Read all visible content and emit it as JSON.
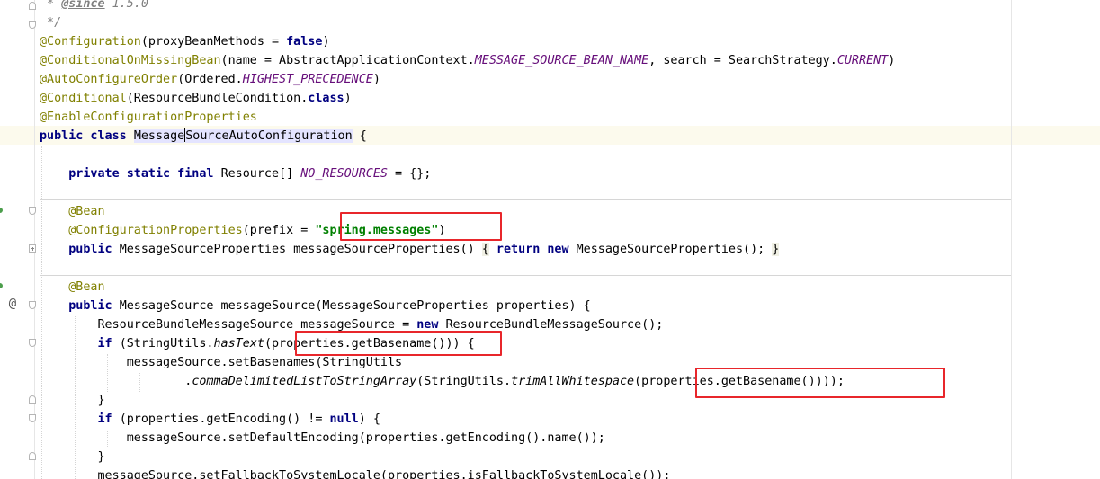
{
  "editor": {
    "lines": [
      {
        "id": "l1",
        "tokens": [
          {
            "t": " * ",
            "c": "cm"
          },
          {
            "t": "@since",
            "c": "cmtag"
          },
          {
            "t": " 1.5.0",
            "c": "cm"
          }
        ]
      },
      {
        "id": "l2",
        "tokens": [
          {
            "t": " */",
            "c": "cm"
          }
        ]
      },
      {
        "id": "l3",
        "tokens": [
          {
            "t": "@Configuration",
            "c": "ann"
          },
          {
            "t": "(proxyBeanMethods = "
          },
          {
            "t": "false",
            "c": "kw"
          },
          {
            "t": ")"
          }
        ]
      },
      {
        "id": "l4",
        "tokens": [
          {
            "t": "@ConditionalOnMissingBean",
            "c": "ann"
          },
          {
            "t": "(name = AbstractApplicationContext."
          },
          {
            "t": "MESSAGE_SOURCE_BEAN_NAME",
            "c": "field"
          },
          {
            "t": ", search = SearchStrategy."
          },
          {
            "t": "CURRENT",
            "c": "field"
          },
          {
            "t": ")"
          }
        ]
      },
      {
        "id": "l5",
        "tokens": [
          {
            "t": "@AutoConfigureOrder",
            "c": "ann"
          },
          {
            "t": "(Ordered."
          },
          {
            "t": "HIGHEST_PRECEDENCE",
            "c": "field"
          },
          {
            "t": ")"
          }
        ]
      },
      {
        "id": "l6",
        "tokens": [
          {
            "t": "@Conditional",
            "c": "ann"
          },
          {
            "t": "(ResourceBundleCondition."
          },
          {
            "t": "class",
            "c": "kw"
          },
          {
            "t": ")"
          }
        ]
      },
      {
        "id": "l7",
        "tokens": [
          {
            "t": "@EnableConfigurationProperties",
            "c": "ann"
          }
        ]
      },
      {
        "id": "l8",
        "tokens": [
          {
            "t": "public class ",
            "c": "kw"
          },
          {
            "t": "Message",
            "c": "cls-hl"
          },
          {
            "caret": true
          },
          {
            "t": "SourceAutoConfiguration",
            "c": "cls-hl"
          },
          {
            "t": " {"
          }
        ]
      },
      {
        "id": "l9",
        "tokens": []
      },
      {
        "id": "l10",
        "tokens": [
          {
            "t": "    "
          },
          {
            "t": "private static final ",
            "c": "kw"
          },
          {
            "t": "Resource[] "
          },
          {
            "t": "NO_RESOURCES",
            "c": "field"
          },
          {
            "t": " = {};"
          }
        ]
      },
      {
        "id": "l11",
        "tokens": []
      },
      {
        "id": "l12",
        "tokens": [
          {
            "t": "    "
          },
          {
            "t": "@Bean",
            "c": "ann"
          }
        ]
      },
      {
        "id": "l13",
        "tokens": [
          {
            "t": "    "
          },
          {
            "t": "@ConfigurationProperties",
            "c": "ann"
          },
          {
            "t": "(prefix = "
          },
          {
            "t": "\"spring.messages\"",
            "c": "str"
          },
          {
            "t": ")"
          }
        ]
      },
      {
        "id": "l14",
        "tokens": [
          {
            "t": "    "
          },
          {
            "t": "public ",
            "c": "kw"
          },
          {
            "t": "MessageSourceProperties messageSourceProperties() "
          },
          {
            "t": "{",
            "c": "brace"
          },
          {
            "t": " "
          },
          {
            "t": "return new ",
            "c": "kw"
          },
          {
            "t": "MessageSourceProperties(); "
          },
          {
            "t": "}",
            "c": "brace"
          }
        ]
      },
      {
        "id": "l15",
        "tokens": []
      },
      {
        "id": "l16",
        "tokens": [
          {
            "t": "    "
          },
          {
            "t": "@Bean",
            "c": "ann"
          }
        ]
      },
      {
        "id": "l17",
        "tokens": [
          {
            "t": "    "
          },
          {
            "t": "public ",
            "c": "kw"
          },
          {
            "t": "MessageSource messageSource(MessageSourceProperties properties) {"
          }
        ]
      },
      {
        "id": "l18",
        "tokens": [
          {
            "t": "        ResourceBundleMessageSource messageSource = "
          },
          {
            "t": "new ",
            "c": "kw"
          },
          {
            "t": "ResourceBundleMessageSource();"
          }
        ]
      },
      {
        "id": "l19",
        "tokens": [
          {
            "t": "        "
          },
          {
            "t": "if ",
            "c": "kw"
          },
          {
            "t": "(StringUtils."
          },
          {
            "t": "hasText",
            "c": "static"
          },
          {
            "t": "(properties.getBasename())) {"
          }
        ]
      },
      {
        "id": "l20",
        "tokens": [
          {
            "t": "            messageSource.setBasenames(StringUtils"
          }
        ]
      },
      {
        "id": "l21",
        "tokens": [
          {
            "t": "                    ."
          },
          {
            "t": "commaDelimitedListToStringArray",
            "c": "static"
          },
          {
            "t": "(StringUtils."
          },
          {
            "t": "trimAllWhitespace",
            "c": "static"
          },
          {
            "t": "(properties.getBasename())));"
          }
        ]
      },
      {
        "id": "l22",
        "tokens": [
          {
            "t": "        }"
          }
        ]
      },
      {
        "id": "l23",
        "tokens": [
          {
            "t": "        "
          },
          {
            "t": "if ",
            "c": "kw"
          },
          {
            "t": "(properties.getEncoding() != "
          },
          {
            "t": "null",
            "c": "kw"
          },
          {
            "t": ") {"
          }
        ]
      },
      {
        "id": "l24",
        "tokens": [
          {
            "t": "            messageSource.setDefaultEncoding(properties.getEncoding().name());"
          }
        ]
      },
      {
        "id": "l25",
        "tokens": [
          {
            "t": "        }"
          }
        ]
      },
      {
        "id": "l26",
        "tokens": [
          {
            "t": "        messageSource.setFallbackToSystemLocale(properties.isFallbackToSystemLocale());"
          }
        ]
      }
    ],
    "gutter": {
      "override_marker": "@"
    },
    "highlight_color": "#e8262b"
  }
}
